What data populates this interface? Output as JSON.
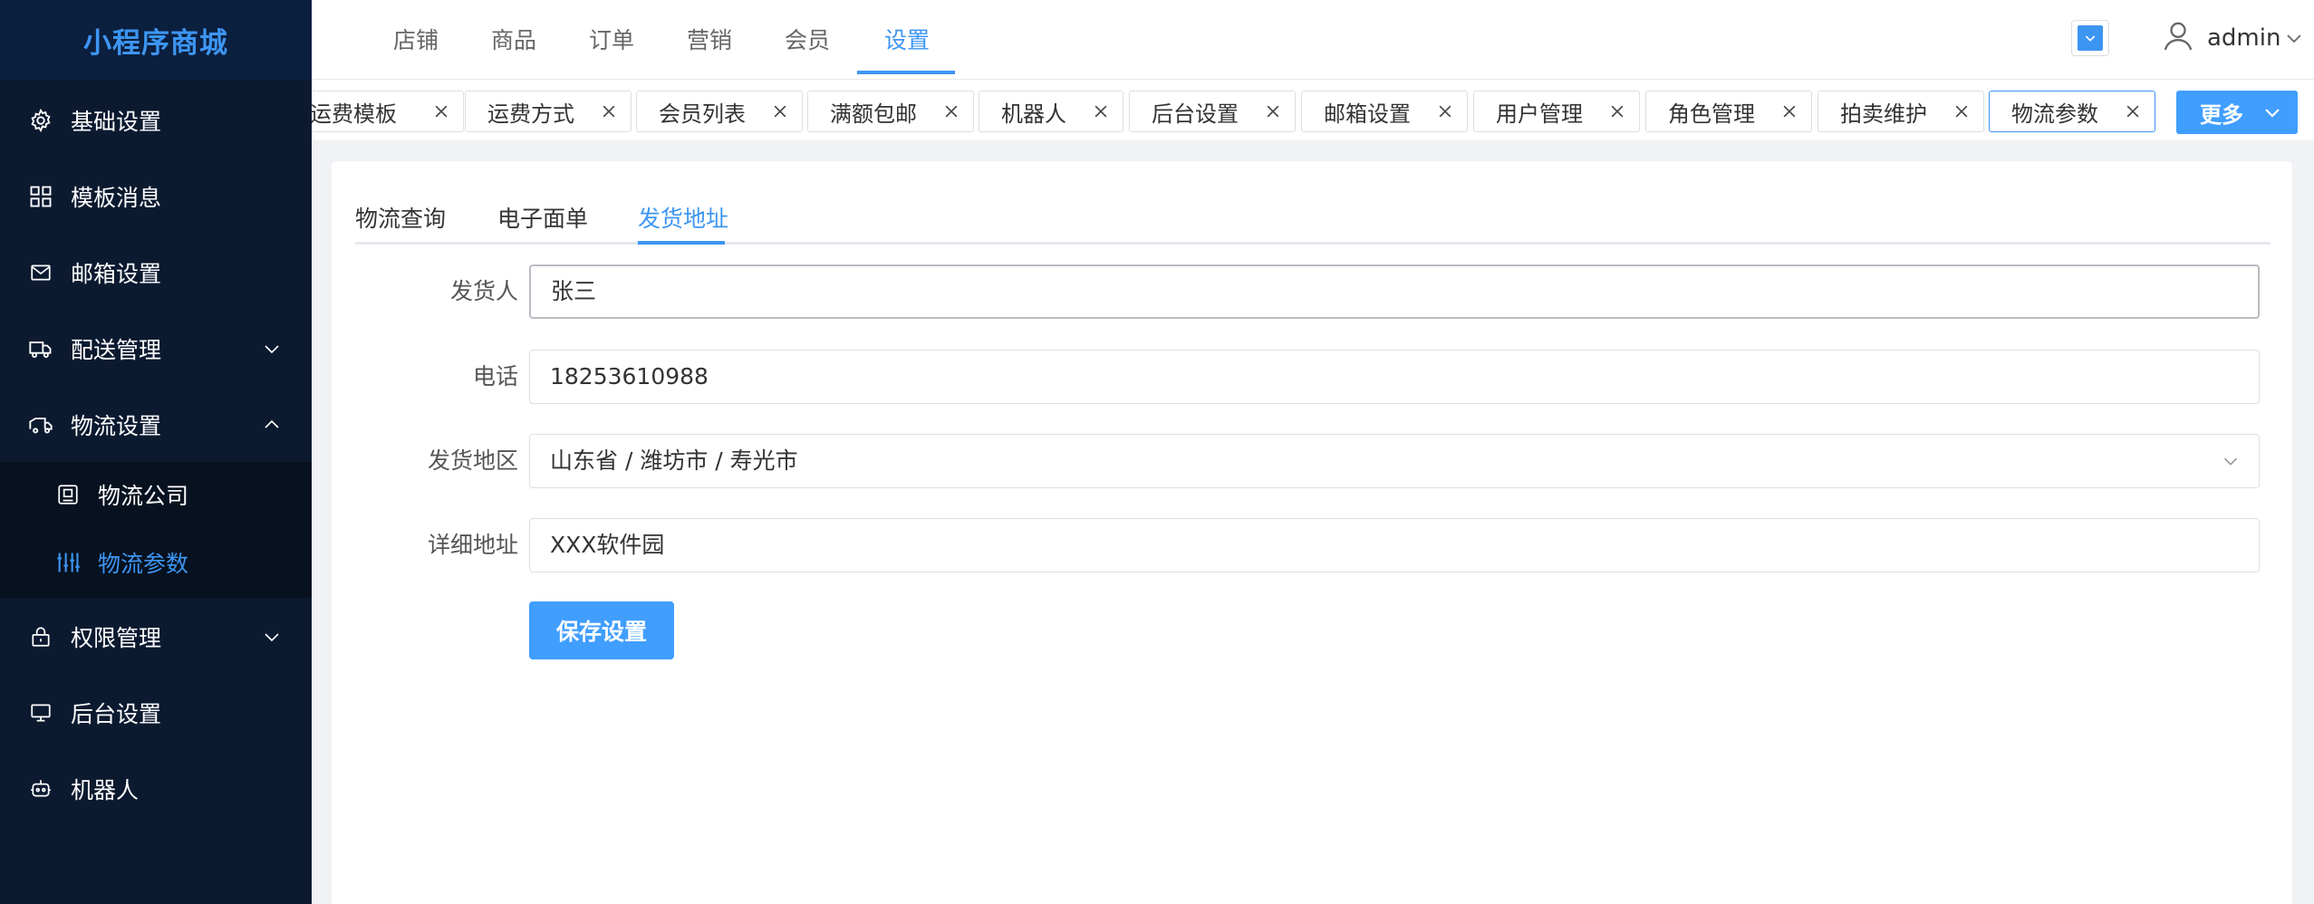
{
  "app": {
    "title": "小程序商城"
  },
  "sidebar": {
    "items": [
      {
        "label": "基础设置",
        "icon": "gear-icon"
      },
      {
        "label": "模板消息",
        "icon": "grid-icon"
      },
      {
        "label": "邮箱设置",
        "icon": "mail-icon"
      },
      {
        "label": "配送管理",
        "icon": "truck-icon",
        "expandable": true,
        "expanded": false
      },
      {
        "label": "物流设置",
        "icon": "van-icon",
        "expandable": true,
        "expanded": true
      },
      {
        "label": "权限管理",
        "icon": "lock-icon",
        "expandable": true,
        "expanded": false
      },
      {
        "label": "后台设置",
        "icon": "monitor-icon"
      },
      {
        "label": "机器人",
        "icon": "robot-icon"
      }
    ],
    "subitems": [
      {
        "label": "物流公司",
        "icon": "company-icon",
        "active": false
      },
      {
        "label": "物流参数",
        "icon": "sliders-icon",
        "active": true
      }
    ]
  },
  "header": {
    "tabs": [
      "店铺",
      "商品",
      "订单",
      "营销",
      "会员",
      "设置"
    ],
    "active_tab": "设置",
    "user": "admin"
  },
  "tags": {
    "items": [
      "运费模板",
      "运费方式",
      "会员列表",
      "满额包邮",
      "机器人",
      "后台设置",
      "邮箱设置",
      "用户管理",
      "角色管理",
      "拍卖维护",
      "物流参数"
    ],
    "active": "物流参数",
    "more_label": "更多"
  },
  "content": {
    "subtabs": [
      "物流查询",
      "电子面单",
      "发货地址"
    ],
    "active_subtab": "发货地址",
    "form": {
      "sender_label": "发货人",
      "sender_value": "张三",
      "phone_label": "电话",
      "phone_value": "18253610988",
      "region_label": "发货地区",
      "region_value": "山东省 / 潍坊市 / 寿光市",
      "address_label": "详细地址",
      "address_value": "XXX软件园",
      "save_label": "保存设置"
    }
  },
  "colors": {
    "accent": "#3d95f2",
    "sidebar_bg": "#0c1a30",
    "primary_button": "#409eff"
  }
}
